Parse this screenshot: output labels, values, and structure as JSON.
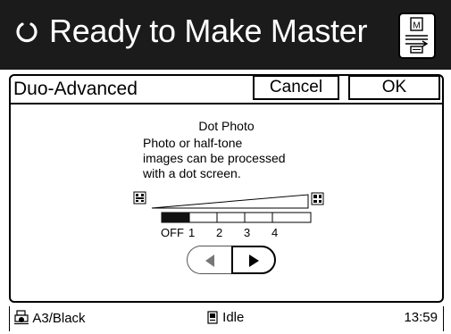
{
  "header": {
    "title": "Ready to Make Master",
    "status_icon": "ready-circle-icon",
    "master_button_icon": "master-document-icon",
    "master_button_letter": "M"
  },
  "panel": {
    "title": "Duo-Advanced",
    "cancel_label": "Cancel",
    "ok_label": "OK"
  },
  "dot_photo": {
    "title": "Dot Photo",
    "description_lines": [
      "Photo or half-tone",
      "images can be processed",
      "with a dot screen."
    ],
    "left_icon": "coarse-dot-icon",
    "right_icon": "fine-dot-icon",
    "levels": [
      "OFF",
      "1",
      "2",
      "3",
      "4"
    ],
    "selected_level": "OFF"
  },
  "nav": {
    "prev_icon": "left-arrow-icon",
    "next_icon": "right-arrow-icon"
  },
  "status": {
    "paper": "A3/Black",
    "paper_icon": "ink-drum-icon",
    "state": "Idle",
    "state_icon": "master-status-icon",
    "time": "13:59"
  },
  "colors": {
    "header_bg": "#1b1b1b",
    "panel_border": "#000000",
    "selected_fill": "#111111",
    "disabled_arrow": "#777777"
  }
}
